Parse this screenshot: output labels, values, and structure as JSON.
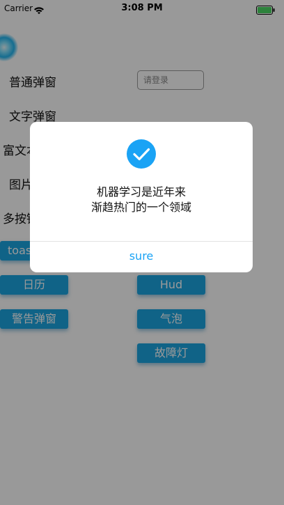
{
  "status_bar": {
    "carrier": "Carrier",
    "time": "3:08 PM",
    "wifi_icon": "wifi-icon",
    "battery_icon": "battery-icon"
  },
  "menu": {
    "items": [
      {
        "label": "普通弹窗"
      },
      {
        "label": "文字弹窗"
      },
      {
        "label": "富文本"
      },
      {
        "label": "图片"
      },
      {
        "label": "多按钮"
      }
    ]
  },
  "login_field": {
    "placeholder": "请登录"
  },
  "buttons": {
    "left": [
      "toast",
      "日历",
      "警告弹窗"
    ],
    "right": [
      "Hud",
      "气泡",
      "故障灯"
    ]
  },
  "dialog": {
    "icon": "checkmark-icon",
    "message_line1": "机器学习是近年来",
    "message_line2": "渐趋热门的一个领域",
    "confirm_label": "sure"
  },
  "colors": {
    "accent": "#1aa3f5",
    "button_blue": "#1ca5e2",
    "overlay": "rgba(0,0,0,0.4)"
  }
}
